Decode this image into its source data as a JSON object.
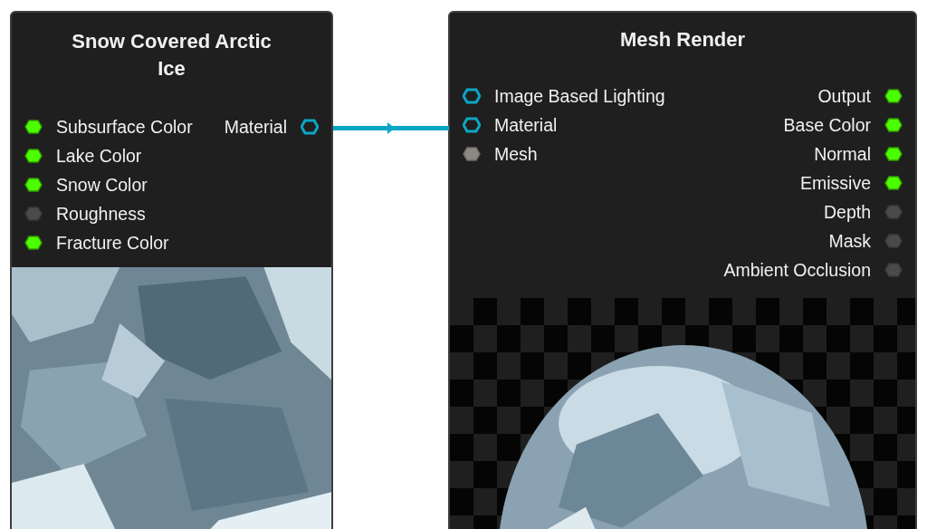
{
  "nodes": [
    {
      "title": "Snow Covered Arctic Ice",
      "inputs": [
        {
          "label": "Subsurface Color",
          "kind": "color"
        },
        {
          "label": "Lake Color",
          "kind": "color"
        },
        {
          "label": "Snow Color",
          "kind": "color"
        },
        {
          "label": "Roughness",
          "kind": "unused"
        },
        {
          "label": "Fracture Color",
          "kind": "color"
        }
      ],
      "outputs": [
        {
          "label": "Material",
          "kind": "material"
        }
      ],
      "preview": {
        "kind": "picture"
      }
    },
    {
      "title": "Mesh Render",
      "inputs": [
        {
          "label": "Image Based Lighting",
          "kind": "material"
        },
        {
          "label": "Material",
          "kind": "material"
        },
        {
          "label": "Mesh",
          "kind": "mesh"
        }
      ],
      "outputs": [
        {
          "label": "Output",
          "kind": "color"
        },
        {
          "label": "Base Color",
          "kind": "color"
        },
        {
          "label": "Normal",
          "kind": "color"
        },
        {
          "label": "Emissive",
          "kind": "color"
        },
        {
          "label": "Depth",
          "kind": "unused"
        },
        {
          "label": "Mask",
          "kind": "unused"
        },
        {
          "label": "Ambient Occlusion",
          "kind": "unused"
        }
      ],
      "preview": {
        "kind": "picture"
      }
    }
  ]
}
